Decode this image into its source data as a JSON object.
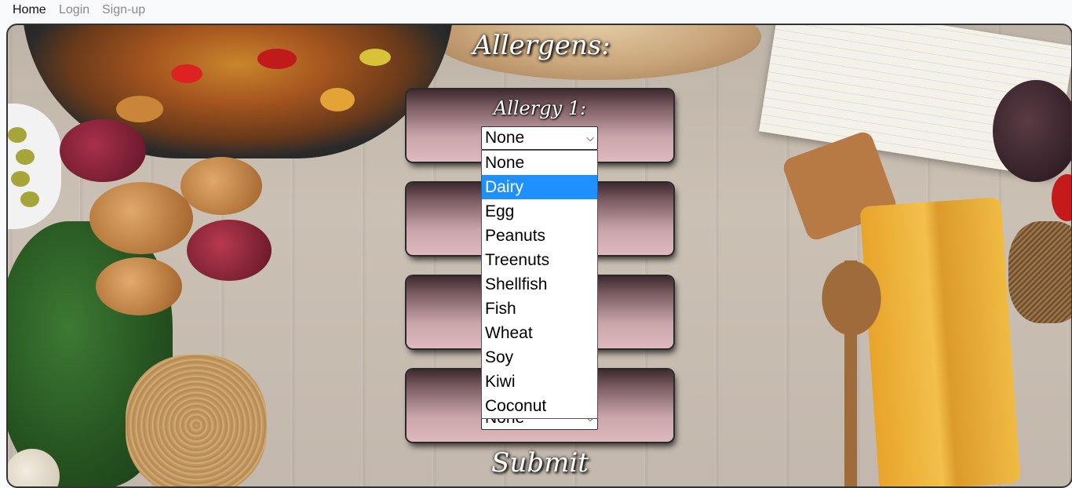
{
  "nav": {
    "home": "Home",
    "login": "Login",
    "signup": "Sign-up"
  },
  "form": {
    "title": "Allergens:",
    "allergy1_label": "Allergy 1:",
    "allergy1_value": "None",
    "allergy4_value": "None",
    "submit_label": "Submit"
  },
  "dropdown": {
    "options": [
      "None",
      "Dairy",
      "Egg",
      "Peanuts",
      "Treenuts",
      "Shellfish",
      "Fish",
      "Wheat",
      "Soy",
      "Kiwi",
      "Coconut"
    ],
    "highlighted": "Dairy"
  },
  "colors": {
    "highlight": "#1e90ff",
    "panel": "#deb9bd"
  }
}
